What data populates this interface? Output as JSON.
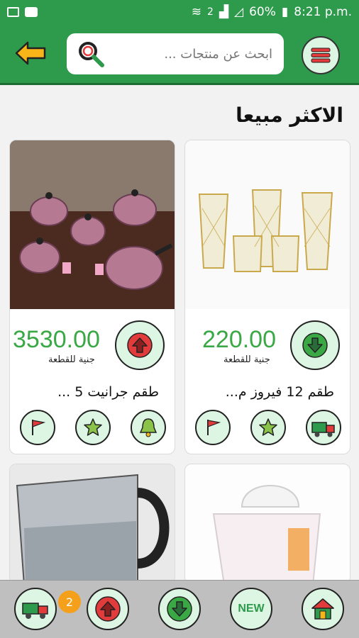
{
  "status_bar": {
    "battery": "60%",
    "time": "8:21 p.m.",
    "sim_label": "2"
  },
  "header": {
    "search_placeholder": "ابحث عن منتجات ...",
    "icons": {
      "back": "arrow-left-icon",
      "search": "search-icon",
      "menu": "hamburger-menu-icon"
    }
  },
  "section": {
    "title": "الاكثر مبيعا"
  },
  "products": [
    {
      "name": "طقم 12 فيروز م...",
      "price": "220.00",
      "unit": "جنية للقطعة",
      "arrow": "down",
      "actions": [
        "truck-icon",
        "star-icon",
        "flag-icon"
      ]
    },
    {
      "name": "طقم جرانيت 5 ...",
      "price": "3530.00",
      "unit": "جنية للقطعة",
      "arrow": "up",
      "actions": [
        "bell-icon",
        "star-icon",
        "flag-icon"
      ]
    },
    {
      "name": "",
      "price": "",
      "unit": ""
    },
    {
      "name": "",
      "price": "",
      "unit": ""
    }
  ],
  "bottom_nav": {
    "cart_badge": "2",
    "new_label": "NEW",
    "items": [
      "home-icon",
      "new-icon",
      "arrow-down-icon",
      "arrow-up-icon",
      "truck-icon"
    ]
  },
  "colors": {
    "primary": "#2e9b4c",
    "price": "#3aa845",
    "button_bg": "#ddf5e3",
    "badge": "#f5a01a"
  }
}
